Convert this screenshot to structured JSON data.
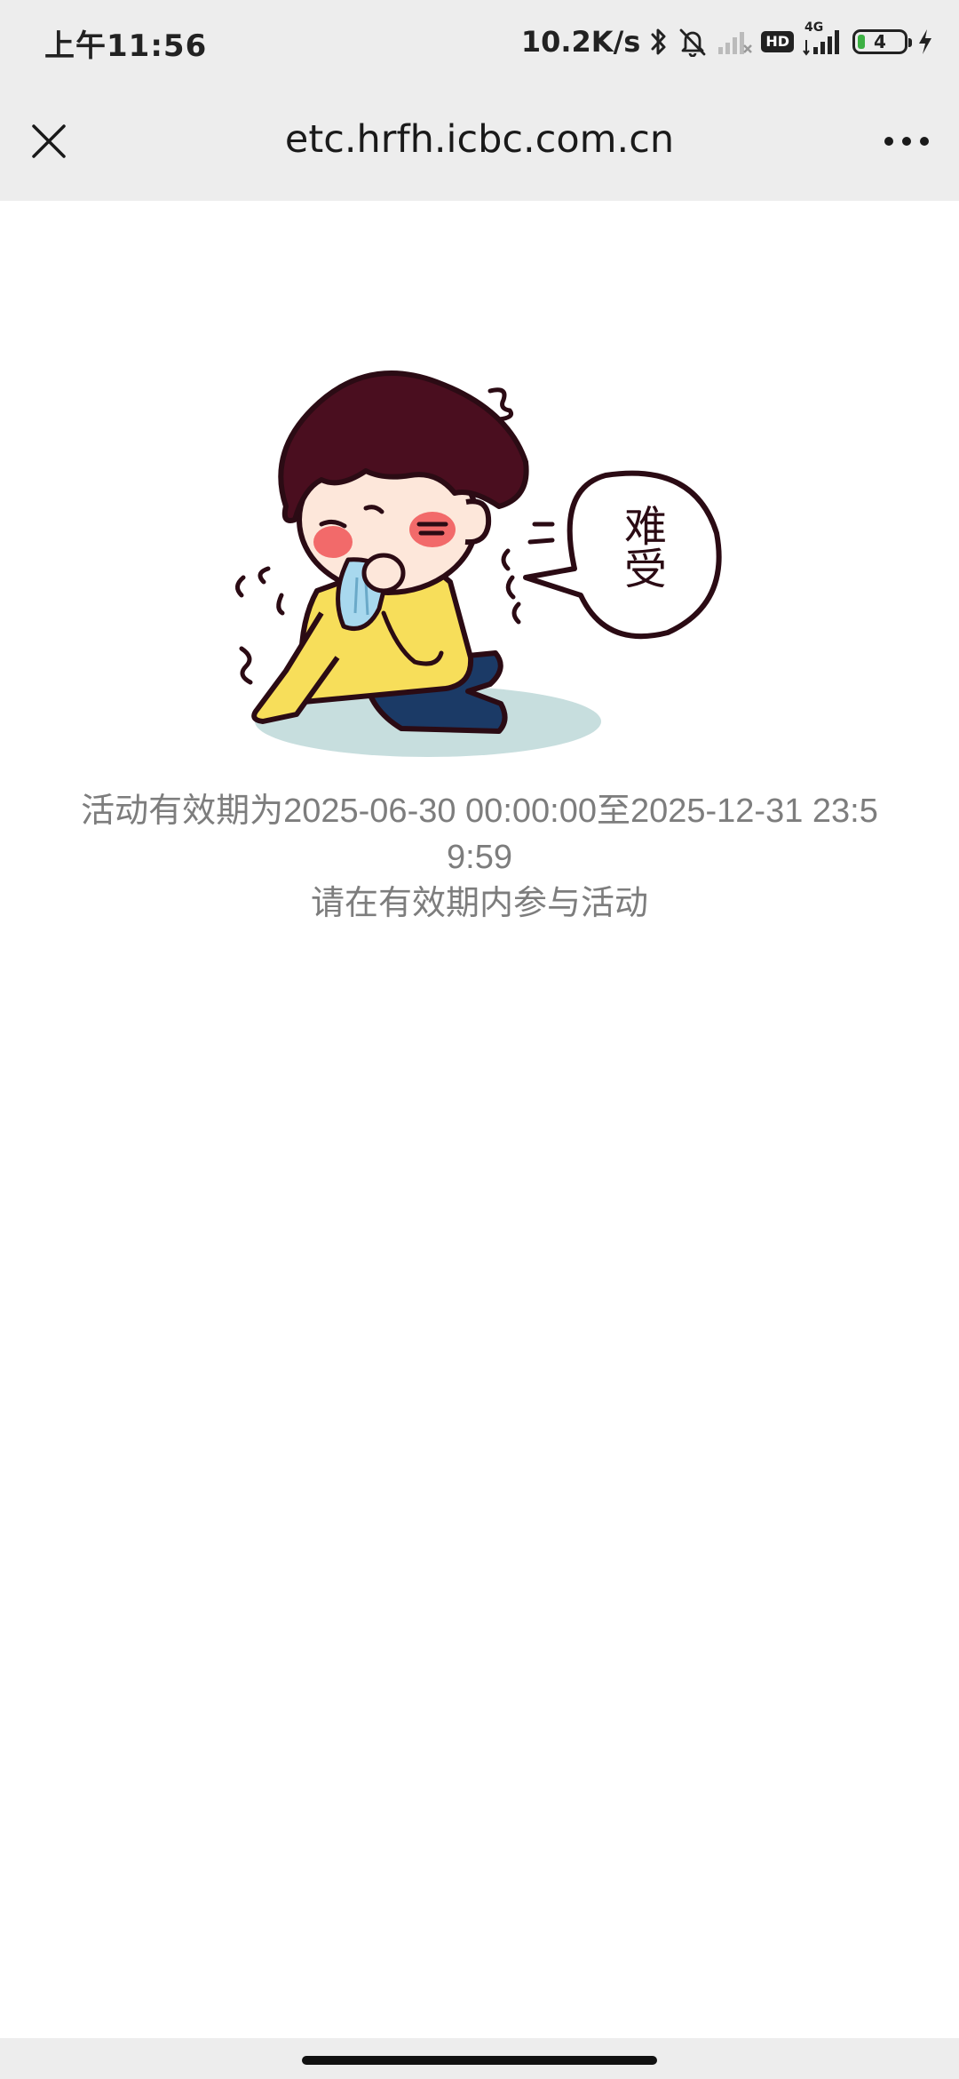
{
  "status_bar": {
    "time": "上午11:56",
    "network_speed": "10.2K/s",
    "hd_label": "HD",
    "network_type": "4G",
    "battery_level": "4",
    "icons": [
      "bluetooth-icon",
      "bell-muted-icon",
      "signal-weak-icon",
      "signal-full-icon",
      "battery-icon",
      "charging-icon"
    ]
  },
  "nav": {
    "title": "etc.hrfh.icbc.com.cn",
    "close_icon": "close-icon",
    "more_icon": "more-icon"
  },
  "content": {
    "illustration_text": "难受",
    "message_line1": "活动有效期为2025-06-30 00:00:00至2025-12-31 23:59:59",
    "message_line2": "请在有效期内参与活动"
  },
  "colors": {
    "bar_background": "#ededed",
    "message_text": "#7d7d7d",
    "hair": "#4a0e1f",
    "shirt": "#f7de5a",
    "pants": "#1b3a66",
    "shadow": "#c7dede"
  }
}
